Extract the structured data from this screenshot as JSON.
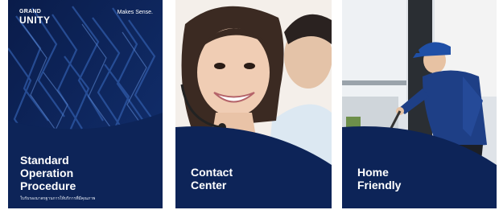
{
  "cards": [
    {
      "brand_line1": "GRAND",
      "brand_line2": "UNITY",
      "tagline": "Makes Sense.",
      "title_lines": [
        "Standard",
        "Operation",
        "Procedure"
      ],
      "subtitle": "ใบรับรองมาตรฐานการให้บริการที่มีคุณภาพ"
    },
    {
      "title_lines": [
        "Contact",
        "Center"
      ]
    },
    {
      "title_lines": [
        "Home",
        "Friendly"
      ]
    }
  ],
  "colors": {
    "navy": "#0d2458",
    "white": "#ffffff"
  }
}
